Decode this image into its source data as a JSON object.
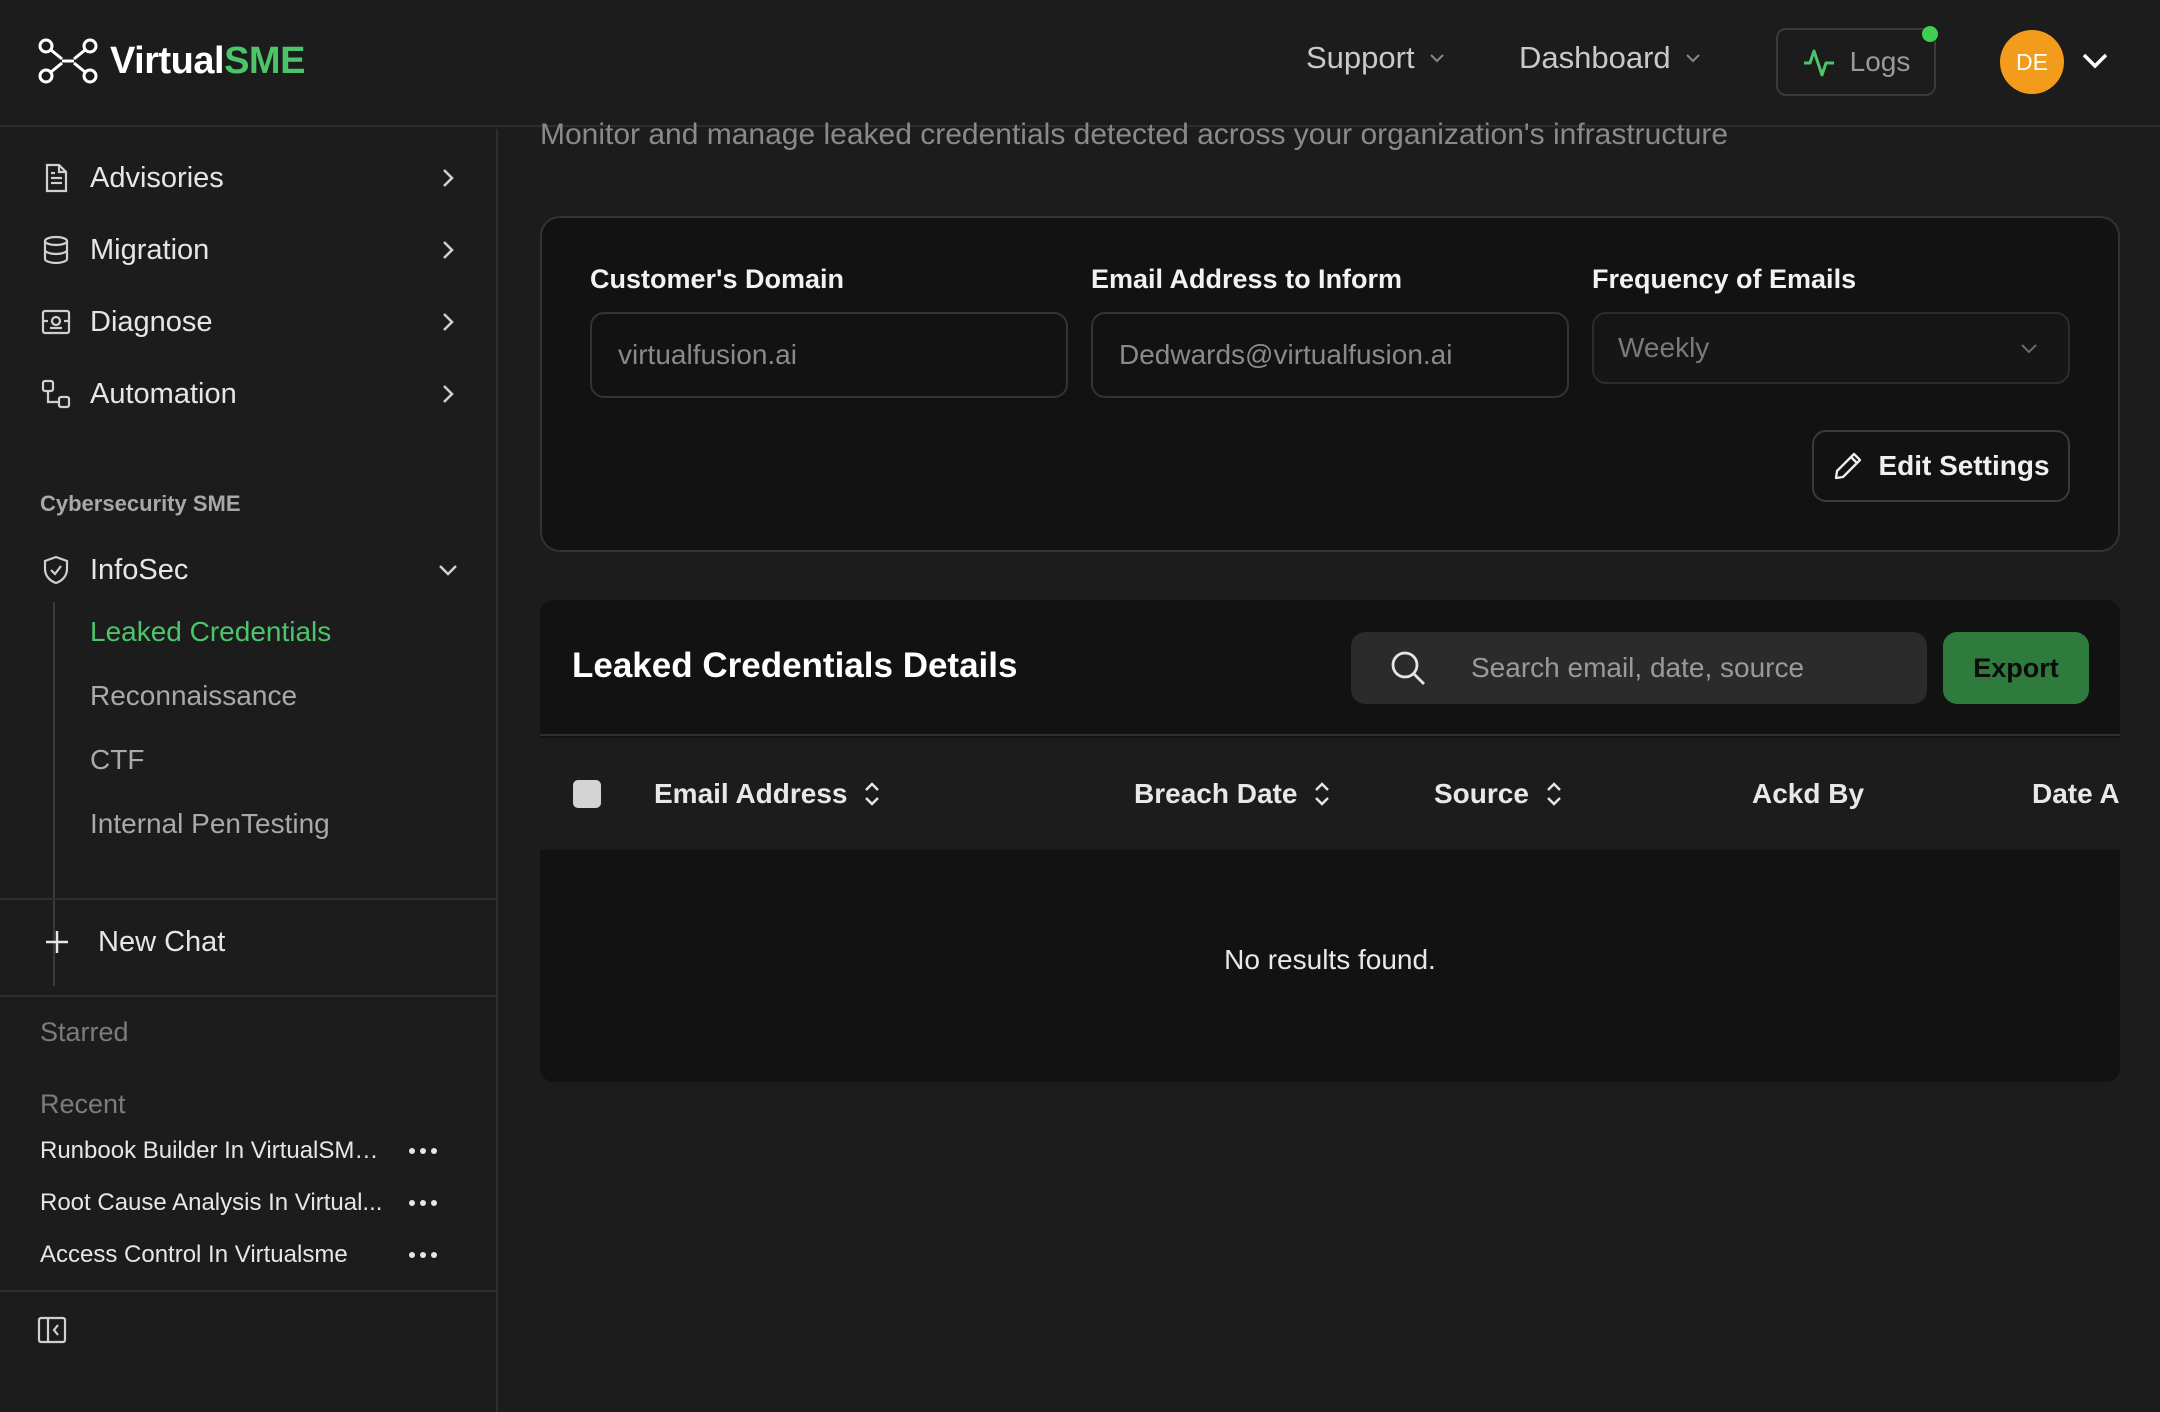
{
  "header": {
    "logo_text_a": "Virtual",
    "logo_text_b": "SME",
    "nav": [
      {
        "label": "Support"
      },
      {
        "label": "Dashboard"
      }
    ],
    "logs_label": "Logs",
    "avatar_initials": "DE"
  },
  "sidebar": {
    "items": [
      {
        "label": "Advisories",
        "icon": "document-icon"
      },
      {
        "label": "Migration",
        "icon": "database-icon"
      },
      {
        "label": "Diagnose",
        "icon": "diagnose-icon"
      },
      {
        "label": "Automation",
        "icon": "workflow-icon"
      }
    ],
    "section_label": "Cybersecurity SME",
    "infosec_label": "InfoSec",
    "sub_items": [
      {
        "label": "Leaked Credentials",
        "active": true
      },
      {
        "label": "Reconnaissance",
        "active": false
      },
      {
        "label": "CTF",
        "active": false
      },
      {
        "label": "Internal PenTesting",
        "active": false
      }
    ],
    "new_chat_label": "New Chat",
    "starred_label": "Starred",
    "recent_label": "Recent",
    "recent_items": [
      {
        "label": "Runbook Builder In VirtualSME..."
      },
      {
        "label": "Root Cause Analysis In Virtual..."
      },
      {
        "label": "Access Control In Virtualsme"
      }
    ]
  },
  "main": {
    "subtitle": "Monitor and manage leaked credentials detected across your organization's infrastructure",
    "settings": {
      "domain_label": "Customer's Domain",
      "domain_value": "virtualfusion.ai",
      "email_label": "Email Address to Inform",
      "email_value": "Dedwards@virtualfusion.ai",
      "frequency_label": "Frequency of Emails",
      "frequency_value": "Weekly",
      "edit_label": "Edit Settings"
    },
    "details": {
      "title": "Leaked Credentials Details",
      "search_placeholder": "Search email, date, source",
      "export_label": "Export",
      "columns": [
        {
          "label": "Email Address"
        },
        {
          "label": "Breach Date"
        },
        {
          "label": "Source"
        },
        {
          "label": "Ackd By"
        },
        {
          "label": "Date Ac"
        }
      ],
      "empty_text": "No results found."
    }
  },
  "colors": {
    "accent_green": "#4cc46a",
    "export_green": "#2f7b3e",
    "avatar_orange": "#f39b1a",
    "status_dot": "#3fcf4e"
  }
}
